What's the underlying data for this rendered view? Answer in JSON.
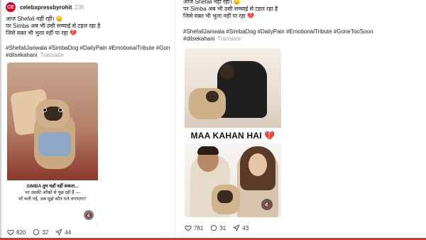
{
  "post1": {
    "avatar_text": "CE",
    "username": "celebxpressbyrohit",
    "time": "23h",
    "caption": [
      "आज Shefali नहीं रहीं। 😞",
      "पर Simba अब भी उसी सच्चाई से टहल रहा है",
      "जिसे वक़्त भी भुला नहीं पा रहा 💔"
    ],
    "hashtags_line1": "#ShefaliJariwala #SimbaDog #DailyPain #EmotionalTribute #GoneTooS",
    "hashtags_line2": "#dilsekahani",
    "translate": "Translate",
    "image_text": {
      "title": "SIMBA तुम यहाँ नहीं सकता...",
      "line2": "पर उसकी आँखों से पूछ रही हैं —",
      "line3": "माँ चली गई, अब मुझे कौन गले लगाएगा?"
    },
    "stats": {
      "likes": "820",
      "comments": "32",
      "shares": "44"
    }
  },
  "post2": {
    "caption": [
      "आज Shefali नहीं रहीं। 😞",
      "पर Simba अब भी उसी सच्चाई से टहल रहा है",
      "जिसे वक़्त भी भुला नहीं पा रहा 💔"
    ],
    "hashtags_line1": "#ShefaliJariwala #SimbaDog #DailyPain #EmotionalTribute #GoneTooSoon",
    "hashtags_line2": "#dilsekahani",
    "translate": "Translate",
    "image_caption": "MAA KAHAN HAI 💔",
    "stats": {
      "likes": "781",
      "comments": "31",
      "shares": "43"
    }
  },
  "colors": {
    "accent_red": "#e0322a",
    "avatar_red": "#c8102e"
  }
}
